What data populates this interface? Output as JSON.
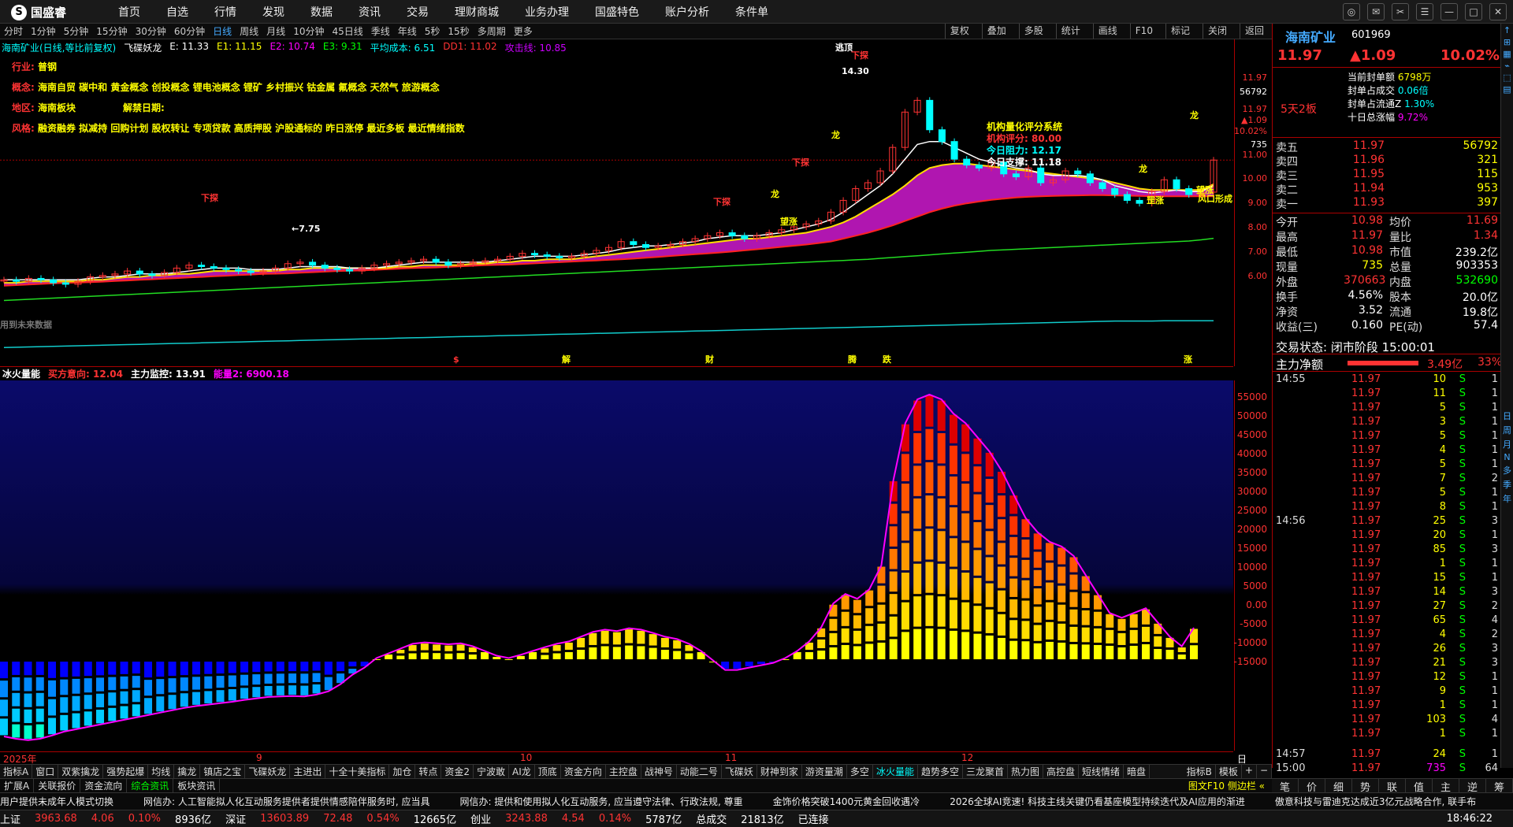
{
  "app": {
    "name": "国盛睿"
  },
  "menu": [
    "首页",
    "自选",
    "行情",
    "发现",
    "数据",
    "资讯",
    "交易",
    "理财商城",
    "业务办理",
    "国盛特色",
    "账户分析",
    "条件单"
  ],
  "periods": [
    "分时",
    "1分钟",
    "5分钟",
    "15分钟",
    "30分钟",
    "60分钟",
    "日线",
    "周线",
    "月线",
    "10分钟",
    "45日线",
    "季线",
    "年线",
    "5秒",
    "15秒",
    "多周期",
    "更多"
  ],
  "period_active": "日线",
  "period_tools": [
    "复权",
    "叠加",
    "多股",
    "统计",
    "画线",
    "F10",
    "标记",
    "关闭",
    "返回"
  ],
  "legend": {
    "stock": "海南矿业(日线,等比前复权)",
    "indicator": "飞碟妖龙",
    "e": "E: 11.33",
    "e1": "E1: 11.15",
    "e2": "E2: 10.74",
    "e3": "E3: 9.31",
    "avg": "平均成本: 6.51",
    "dd1": "DD1: 11.02",
    "atk": "攻击线: 10.85"
  },
  "info": {
    "industry_k": "行业:",
    "industry_v": "普钢",
    "concept_k": "概念:",
    "concept_v": "海南自贸 碳中和 黄金概念 创投概念 锂电池概念 锂矿 乡村振兴 钴金属 氟概念 天然气 旅游概念",
    "region_k": "地区:",
    "region_v": "海南板块",
    "unlock_k": "解禁日期:",
    "style_k": "风格:",
    "style_v": "融资融券 拟减持 回购计划 股权转让 专项贷款 高质押股 沪股通标的 昨日涨停 最近多板 最近情绪指数"
  },
  "rating": {
    "title": "机构量化评分系统",
    "score": "机构评分: 80.00",
    "res": "今日阻力: 12.17",
    "sup": "今日支撑: 11.18",
    "resist_v": "12.17",
    "support_v": "11.18"
  },
  "chart_labels": {
    "low_price": "←7.75",
    "high_price": "14.30",
    "future": "用到未来数据",
    "signal_a": "下探",
    "signal_b": "龙",
    "signal_c": "望涨",
    "signal_d": "罡涨",
    "signal_e": "风口形成",
    "signal_f": "逃顶",
    "event_1": "$",
    "event_2": "解",
    "event_3": "财",
    "event_4": "腾",
    "event_5": "跌",
    "event_6": "涨"
  },
  "yaxis_main": [
    "11.97",
    "56792",
    "11.97",
    "▲1.09",
    "10.02%",
    "735",
    "11.00",
    "10.00",
    "9.00",
    "8.00",
    "7.00",
    "6.00"
  ],
  "sub_legend": {
    "name": "冰火量能",
    "buy": "买方意向: 12.04",
    "main": "主力监控: 13.91",
    "energy": "能量2: 6900.18"
  },
  "yaxis_sub": [
    "55000",
    "50000",
    "45000",
    "40000",
    "35000",
    "30000",
    "25000",
    "20000",
    "15000",
    "10000",
    "5000",
    "0.00",
    "-5000",
    "-10000",
    "-15000"
  ],
  "xaxis": {
    "year": "2025年",
    "m9": "9",
    "m10": "10",
    "m11": "11",
    "m12": "12",
    "label": "日线"
  },
  "chart_data": [
    {
      "type": "candlestick",
      "title": "海南矿业(日线,等比前复权)",
      "ylim": [
        5.5,
        15
      ],
      "close": [
        7.9,
        7.85,
        7.95,
        7.9,
        7.8,
        7.75,
        7.85,
        8.0,
        8.05,
        8.1,
        8.2,
        8.1,
        8.05,
        8.15,
        8.3,
        8.4,
        8.35,
        8.3,
        8.25,
        8.2,
        8.15,
        8.2,
        8.3,
        8.45,
        8.5,
        8.4,
        8.3,
        8.25,
        8.2,
        8.3,
        8.4,
        8.45,
        8.5,
        8.55,
        8.6,
        8.5,
        8.4,
        8.45,
        8.5,
        8.55,
        8.6,
        8.7,
        8.8,
        8.75,
        8.7,
        8.65,
        8.7,
        8.8,
        8.9,
        9.0,
        9.2,
        9.1,
        9.0,
        9.05,
        9.1,
        9.2,
        9.3,
        9.4,
        9.5,
        9.4,
        9.3,
        9.4,
        9.5,
        9.6,
        9.7,
        9.8,
        9.9,
        10.2,
        10.6,
        11.0,
        11.2,
        11.6,
        12.4,
        13.6,
        14.0,
        13.0,
        12.6,
        12.0,
        11.8,
        11.7,
        11.9,
        11.5,
        11.4,
        11.7,
        11.2,
        11.3,
        11.6,
        11.5,
        11.2,
        11.0,
        10.8,
        10.6,
        10.5,
        10.9,
        11.3,
        11.0,
        10.8,
        10.88,
        11.97
      ],
      "ma_white": [
        7.9,
        7.9,
        7.9,
        7.9,
        7.9,
        7.9,
        7.9,
        7.95,
        8.0,
        8.0,
        8.05,
        8.1,
        8.1,
        8.1,
        8.15,
        8.2,
        8.25,
        8.3,
        8.3,
        8.3,
        8.25,
        8.25,
        8.25,
        8.3,
        8.35,
        8.35,
        8.35,
        8.35,
        8.3,
        8.3,
        8.3,
        8.35,
        8.4,
        8.45,
        8.5,
        8.5,
        8.5,
        8.5,
        8.5,
        8.5,
        8.55,
        8.6,
        8.65,
        8.7,
        8.7,
        8.7,
        8.7,
        8.75,
        8.8,
        8.85,
        8.95,
        9.0,
        9.05,
        9.05,
        9.1,
        9.15,
        9.2,
        9.3,
        9.35,
        9.4,
        9.4,
        9.4,
        9.45,
        9.5,
        9.6,
        9.7,
        9.8,
        9.95,
        10.2,
        10.5,
        10.8,
        11.1,
        11.5,
        12.0,
        12.5,
        12.6,
        12.6,
        12.4,
        12.2,
        12.0,
        11.9,
        11.8,
        11.7,
        11.65,
        11.5,
        11.45,
        11.45,
        11.45,
        11.4,
        11.3,
        11.1,
        11.0,
        10.9,
        10.85,
        10.9,
        10.95,
        10.9,
        10.9,
        11.1
      ],
      "ma_yellow": [
        7.8,
        7.8,
        7.85,
        7.85,
        7.85,
        7.85,
        7.85,
        7.9,
        7.9,
        7.95,
        8.0,
        8.0,
        8.05,
        8.05,
        8.1,
        8.1,
        8.15,
        8.2,
        8.2,
        8.2,
        8.2,
        8.2,
        8.2,
        8.25,
        8.25,
        8.3,
        8.3,
        8.3,
        8.3,
        8.3,
        8.3,
        8.3,
        8.35,
        8.35,
        8.4,
        8.4,
        8.4,
        8.4,
        8.45,
        8.45,
        8.5,
        8.5,
        8.55,
        8.55,
        8.6,
        8.6,
        8.6,
        8.65,
        8.7,
        8.75,
        8.8,
        8.85,
        8.9,
        8.95,
        9.0,
        9.05,
        9.1,
        9.15,
        9.2,
        9.25,
        9.3,
        9.3,
        9.35,
        9.4,
        9.45,
        9.5,
        9.6,
        9.7,
        9.85,
        10.05,
        10.3,
        10.55,
        10.8,
        11.1,
        11.45,
        11.7,
        11.8,
        11.85,
        11.85,
        11.8,
        11.75,
        11.7,
        11.65,
        11.6,
        11.55,
        11.5,
        11.45,
        11.4,
        11.35,
        11.3,
        11.2,
        11.1,
        11.0,
        10.95,
        10.95,
        10.95,
        10.95,
        10.95,
        11.15
      ],
      "ma_red": [
        7.7,
        7.72,
        7.74,
        7.76,
        7.78,
        7.8,
        7.81,
        7.82,
        7.84,
        7.86,
        7.88,
        7.9,
        7.92,
        7.94,
        7.96,
        7.98,
        8.0,
        8.02,
        8.04,
        8.06,
        8.08,
        8.1,
        8.11,
        8.12,
        8.14,
        8.16,
        8.18,
        8.2,
        8.21,
        8.22,
        8.24,
        8.26,
        8.28,
        8.3,
        8.31,
        8.32,
        8.34,
        8.36,
        8.38,
        8.4,
        8.41,
        8.42,
        8.44,
        8.46,
        8.48,
        8.5,
        8.52,
        8.54,
        8.56,
        8.58,
        8.6,
        8.62,
        8.65,
        8.68,
        8.71,
        8.74,
        8.77,
        8.8,
        8.83,
        8.86,
        8.9,
        8.94,
        8.98,
        9.02,
        9.06,
        9.1,
        9.15,
        9.2,
        9.3,
        9.4,
        9.5,
        9.62,
        9.75,
        9.9,
        10.05,
        10.2,
        10.32,
        10.42,
        10.5,
        10.56,
        10.62,
        10.66,
        10.7,
        10.72,
        10.74,
        10.75,
        10.76,
        10.77,
        10.78,
        10.78,
        10.77,
        10.76,
        10.75,
        10.74,
        10.74,
        10.74,
        10.74,
        10.74,
        10.74
      ],
      "ma_green": [
        7.2,
        7.22,
        7.24,
        7.26,
        7.28,
        7.3,
        7.32,
        7.34,
        7.36,
        7.38,
        7.4,
        7.42,
        7.44,
        7.46,
        7.48,
        7.5,
        7.52,
        7.54,
        7.56,
        7.58,
        7.6,
        7.62,
        7.64,
        7.66,
        7.68,
        7.7,
        7.72,
        7.74,
        7.76,
        7.78,
        7.8,
        7.82,
        7.84,
        7.86,
        7.88,
        7.9,
        7.92,
        7.94,
        7.96,
        7.98,
        8.0,
        8.02,
        8.04,
        8.06,
        8.08,
        8.1,
        8.12,
        8.14,
        8.16,
        8.18,
        8.2,
        8.22,
        8.24,
        8.26,
        8.28,
        8.3,
        8.32,
        8.34,
        8.36,
        8.38,
        8.4,
        8.42,
        8.44,
        8.46,
        8.48,
        8.5,
        8.52,
        8.54,
        8.56,
        8.58,
        8.6,
        8.63,
        8.66,
        8.69,
        8.72,
        8.75,
        8.78,
        8.81,
        8.84,
        8.87,
        8.9,
        8.92,
        8.94,
        8.96,
        8.98,
        9.0,
        9.02,
        9.04,
        9.06,
        9.08,
        9.1,
        9.12,
        9.14,
        9.16,
        9.18,
        9.2,
        9.22,
        9.26,
        9.31
      ],
      "ma_cyan": [
        5.6,
        5.61,
        5.62,
        5.63,
        5.64,
        5.65,
        5.66,
        5.67,
        5.68,
        5.69,
        5.7,
        5.71,
        5.72,
        5.73,
        5.74,
        5.75,
        5.76,
        5.77,
        5.78,
        5.79,
        5.8,
        5.81,
        5.82,
        5.83,
        5.84,
        5.85,
        5.86,
        5.87,
        5.88,
        5.89,
        5.9,
        5.91,
        5.92,
        5.93,
        5.94,
        5.95,
        5.96,
        5.97,
        5.98,
        5.99,
        6.0,
        6.01,
        6.02,
        6.03,
        6.04,
        6.05,
        6.06,
        6.07,
        6.08,
        6.09,
        6.1,
        6.11,
        6.12,
        6.13,
        6.14,
        6.15,
        6.16,
        6.17,
        6.18,
        6.19,
        6.2,
        6.21,
        6.22,
        6.23,
        6.24,
        6.25,
        6.26,
        6.27,
        6.28,
        6.29,
        6.3,
        6.31,
        6.32,
        6.33,
        6.34,
        6.35,
        6.36,
        6.37,
        6.38,
        6.39,
        6.4,
        6.41,
        6.42,
        6.43,
        6.44,
        6.45,
        6.46,
        6.47,
        6.48,
        6.49,
        6.5,
        6.5,
        6.5,
        6.5,
        6.51,
        6.51,
        6.51,
        6.51,
        6.51
      ]
    },
    {
      "type": "bar",
      "title": "冰火量能",
      "ylim": [
        -17000,
        57000
      ],
      "values": [
        -16000,
        -16500,
        -16800,
        -16500,
        -15800,
        -15000,
        -14500,
        -14000,
        -13500,
        -13000,
        -12500,
        -12000,
        -11500,
        -11000,
        -10500,
        -10000,
        -9600,
        -9300,
        -9000,
        -8700,
        -8300,
        -8000,
        -7700,
        -7600,
        -7500,
        -7600,
        -7200,
        -6500,
        -5000,
        -3000,
        -1500,
        500,
        1500,
        2500,
        3500,
        3800,
        3600,
        3400,
        3600,
        3000,
        2000,
        1000,
        500,
        1200,
        2000,
        2800,
        3500,
        4000,
        5000,
        6000,
        6500,
        6200,
        6800,
        6500,
        5800,
        5000,
        4500,
        3500,
        2000,
        0,
        -2000,
        -2000,
        -1500,
        -1000,
        -500,
        500,
        2000,
        4000,
        7000,
        12000,
        14000,
        13000,
        15000,
        20000,
        38000,
        50000,
        55000,
        56000,
        55000,
        52000,
        50000,
        47000,
        44000,
        40000,
        35000,
        30000,
        27000,
        25000,
        24000,
        22000,
        18000,
        14000,
        10000,
        9000,
        10000,
        11000,
        8000,
        5000,
        3000,
        6900
      ]
    }
  ],
  "quote": {
    "name": "海南矿业",
    "code": "601969",
    "price": "11.97",
    "change": "▲1.09",
    "pct": "10.02%",
    "seal_label": "当前封单额",
    "seal_v": "6798万",
    "seal_deal_label": "封单占成交",
    "seal_deal_v": "0.06倍",
    "seal_float_label": "封单占流通Z",
    "seal_float_v": "1.30%",
    "ten_label": "十日总涨幅",
    "ten_v": "9.72%",
    "board": "5天2板",
    "sells": [
      [
        "卖五",
        "11.97",
        "56792"
      ],
      [
        "卖四",
        "11.96",
        "321"
      ],
      [
        "卖三",
        "11.95",
        "115"
      ],
      [
        "卖二",
        "11.94",
        "953"
      ],
      [
        "卖一",
        "11.93",
        "397"
      ]
    ],
    "stats": [
      [
        "今开",
        "10.98",
        "均价",
        "11.69"
      ],
      [
        "最高",
        "11.97",
        "量比",
        "1.34"
      ],
      [
        "最低",
        "10.98",
        "市值",
        "239.2亿"
      ],
      [
        "现量",
        "735",
        "总量",
        "903353"
      ],
      [
        "外盘",
        "370663",
        "内盘",
        "532690"
      ],
      [
        "换手",
        "4.56%",
        "股本",
        "20.0亿"
      ],
      [
        "净资",
        "3.52",
        "流通",
        "19.8亿"
      ],
      [
        "收益(三)",
        "0.160",
        "PE(动)",
        "57.4"
      ]
    ],
    "trade_state": "交易状态: 闭市阶段 15:00:01",
    "main_net_label": "主力净额",
    "main_net": "3.49亿",
    "main_pct": "33%",
    "trades": [
      [
        "14:55",
        "11.97",
        "10",
        "S",
        "1"
      ],
      [
        "",
        "11.97",
        "11",
        "S",
        "1"
      ],
      [
        "",
        "11.97",
        "5",
        "S",
        "1"
      ],
      [
        "",
        "11.97",
        "3",
        "S",
        "1"
      ],
      [
        "",
        "11.97",
        "5",
        "S",
        "1"
      ],
      [
        "",
        "11.97",
        "4",
        "S",
        "1"
      ],
      [
        "",
        "11.97",
        "5",
        "S",
        "1"
      ],
      [
        "",
        "11.97",
        "7",
        "S",
        "2"
      ],
      [
        "",
        "11.97",
        "5",
        "S",
        "1"
      ],
      [
        "",
        "11.97",
        "8",
        "S",
        "1"
      ],
      [
        "14:56",
        "11.97",
        "25",
        "S",
        "3"
      ],
      [
        "",
        "11.97",
        "20",
        "S",
        "1"
      ],
      [
        "",
        "11.97",
        "85",
        "S",
        "3"
      ],
      [
        "",
        "11.97",
        "1",
        "S",
        "1"
      ],
      [
        "",
        "11.97",
        "15",
        "S",
        "1"
      ],
      [
        "",
        "11.97",
        "14",
        "S",
        "3"
      ],
      [
        "",
        "11.97",
        "27",
        "S",
        "2"
      ],
      [
        "",
        "11.97",
        "65",
        "S",
        "4"
      ],
      [
        "",
        "11.97",
        "4",
        "S",
        "2"
      ],
      [
        "",
        "11.97",
        "26",
        "S",
        "3"
      ],
      [
        "",
        "11.97",
        "21",
        "S",
        "3"
      ],
      [
        "",
        "11.97",
        "12",
        "S",
        "1"
      ],
      [
        "",
        "11.97",
        "9",
        "S",
        "1"
      ],
      [
        "",
        "11.97",
        "1",
        "S",
        "1"
      ],
      [
        "",
        "11.97",
        "103",
        "S",
        "4"
      ],
      [
        "",
        "11.97",
        "1",
        "S",
        "1"
      ],
      [
        "14:57",
        "11.97",
        "24",
        "S",
        "1"
      ],
      [
        "15:00",
        "11.97",
        "735",
        "S",
        "64"
      ]
    ]
  },
  "side_tabs": [
    "日",
    "周",
    "月",
    "N",
    "多",
    "季",
    "年"
  ],
  "bottom_tabs": [
    "指标A",
    "窗口",
    "双紫擒龙",
    "强势起爆",
    "均线",
    "擒龙",
    "镇店之宝",
    "飞碟妖龙",
    "主进出",
    "十全十美指标",
    "加仓",
    "转点",
    "资金2",
    "宁波敢",
    "AI龙",
    "顶底",
    "资金方向",
    "主控盘",
    "战神号",
    "动能二号",
    "飞碟妖",
    "财神到家",
    "游资量潮",
    "多空",
    "冰火量能",
    "趋势多空",
    "三龙聚首",
    "热力图",
    "高控盘",
    "短线情绪",
    "暗盘"
  ],
  "bottom_tabs_right": [
    "指标B",
    "模板",
    "+",
    "−"
  ],
  "tabs2": [
    "扩展A",
    "关联报价",
    "资金流向",
    "综合资讯",
    "板块资讯"
  ],
  "tabs2_right": "图文F10 侧边栏 «",
  "rp_tabs": [
    "笔",
    "价",
    "细",
    "势",
    "联",
    "值",
    "主",
    "逆",
    "筹"
  ],
  "news": [
    "用户提供未成年人模式切换",
    "网信办: 人工智能拟人化互动服务提供者提供情感陪伴服务时, 应当具",
    "网信办: 提供和使用拟人化互动服务, 应当遵守法律、行政法规, 尊重",
    "金饰价格突破1400元黄金回收遇冷",
    "2026全球AI竞速! 科技主线关键仍看基座模型持续迭代及AI应用的渐进",
    "傲意科技与雷迪克达成近3亿元战略合作, 联手布"
  ],
  "status": {
    "sh_label": "上证",
    "sh_v": "3963.68",
    "sh_c": "4.06",
    "sh_p": "0.10%",
    "sh_a": "8936亿",
    "sz_label": "深证",
    "sz_v": "13603.89",
    "sz_c": "72.48",
    "sz_p": "0.54%",
    "sz_a": "12665亿",
    "cy_label": "创业",
    "cy_v": "3243.88",
    "cy_c": "4.54",
    "cy_p": "0.14%",
    "cy_a": "5787亿",
    "total_label": "总成交",
    "total_v": "21813亿",
    "conn": "已连接",
    "time": "18:46:22"
  }
}
